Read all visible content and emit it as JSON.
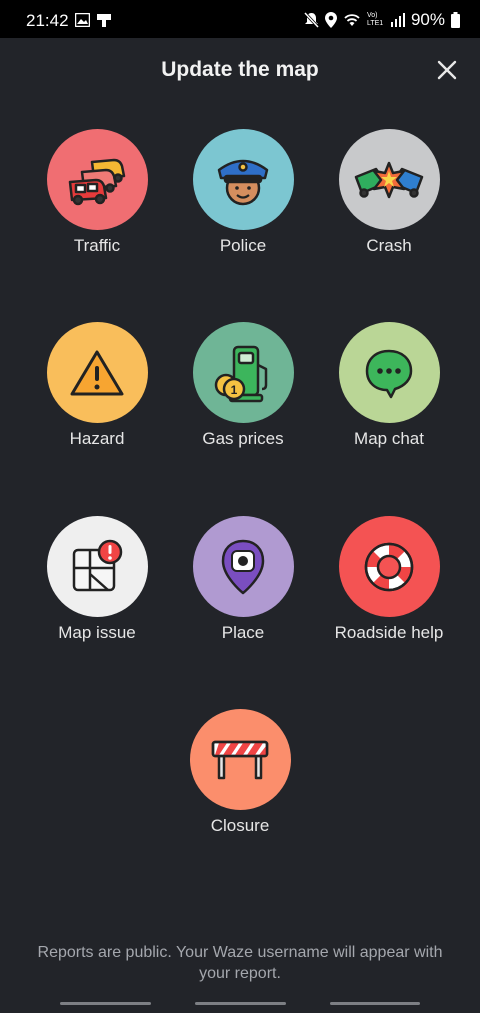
{
  "status_bar": {
    "time": "21:42",
    "battery": "90%",
    "network_label": "Vo) LTE1"
  },
  "dialog": {
    "title": "Update the map",
    "close_icon": "close-icon"
  },
  "reports": [
    {
      "label": "Traffic",
      "icon": "traffic-icon",
      "color": "#f06e72"
    },
    {
      "label": "Police",
      "icon": "police-icon",
      "color": "#7cc6d1"
    },
    {
      "label": "Crash",
      "icon": "crash-icon",
      "color": "#c8c9cb"
    },
    {
      "label": "Hazard",
      "icon": "hazard-icon",
      "color": "#f9be5b"
    },
    {
      "label": "Gas prices",
      "icon": "gas-pump-icon",
      "color": "#6fb596"
    },
    {
      "label": "Map chat",
      "icon": "chat-bubble-icon",
      "color": "#bad696"
    },
    {
      "label": "Map issue",
      "icon": "map-issue-icon",
      "color": "#efefef"
    },
    {
      "label": "Place",
      "icon": "camera-pin-icon",
      "color": "#b09ad1"
    },
    {
      "label": "Roadside help",
      "icon": "lifebuoy-icon",
      "color": "#f45353"
    },
    {
      "label": "Closure",
      "icon": "road-barrier-icon",
      "color": "#fb8e6c"
    }
  ],
  "footer": {
    "text": "Reports are public. Your Waze username will appear with your report."
  }
}
